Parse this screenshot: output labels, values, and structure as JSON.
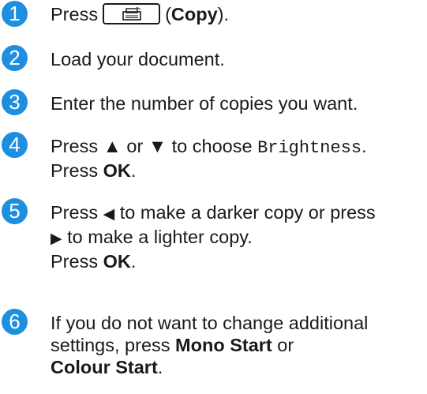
{
  "steps": [
    {
      "number": "1",
      "press": "Press",
      "key_icon": "copy-key-icon",
      "paren_open": "(",
      "copy_label": "Copy",
      "paren_close": ")."
    },
    {
      "number": "2",
      "text": "Load your document."
    },
    {
      "number": "3",
      "text": "Enter the number of copies you want."
    },
    {
      "number": "4",
      "press": "Press",
      "up_arrow": "▲",
      "or": "or",
      "down_arrow": "▼",
      "to_choose": "to choose",
      "option": "Brightness",
      "period": ".",
      "press2": "Press",
      "ok": "OK",
      "period2": "."
    },
    {
      "number": "5",
      "press": "Press",
      "left_arrow": "◀",
      "darker": "to make a darker copy or press",
      "right_arrow": "▶",
      "lighter": "to make a lighter copy.",
      "press2": "Press",
      "ok": "OK",
      "period2": "."
    },
    {
      "number": "6",
      "line1": "If you do not want to change additional",
      "line2": "settings, press",
      "mono_start": "Mono Start",
      "or": "or",
      "colour_start": "Colour Start",
      "period": "."
    }
  ],
  "colors": {
    "step_badge": "#1e8fe0",
    "text": "#1a1a1a"
  }
}
